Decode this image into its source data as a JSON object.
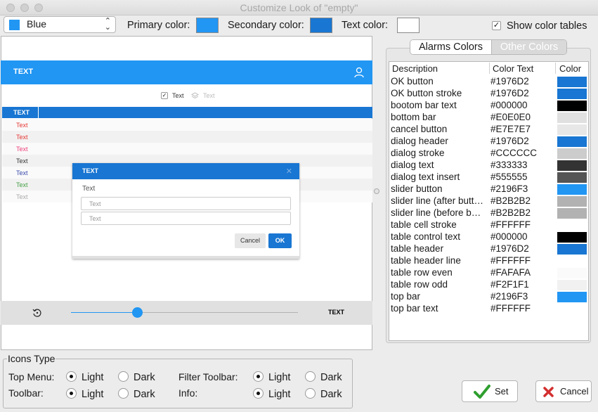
{
  "window": {
    "title": "Customize Look of \"empty\""
  },
  "toolbar": {
    "theme": {
      "selected": "Blue",
      "swatch_color": "#2196F3"
    },
    "primary_label": "Primary color:",
    "primary_color": "#2196F3",
    "secondary_label": "Secondary color:",
    "secondary_color": "#1976D2",
    "text_label": "Text color:",
    "text_color": "#FFFFFF",
    "show_tables_label": "Show color tables",
    "show_tables_checked": true
  },
  "preview": {
    "top_bar_text": "TEXT",
    "filter": {
      "checked_label": "Text",
      "unchecked_label": "Text"
    },
    "table_header": "TEXT",
    "rows": [
      {
        "text": "Text",
        "color": "#E53935"
      },
      {
        "text": "Text",
        "color": "#E53935"
      },
      {
        "text": "Text",
        "color": "#EC407A"
      },
      {
        "text": "Text",
        "color": "#333333"
      },
      {
        "text": "Text",
        "color": "#3949AB"
      },
      {
        "text": "Text",
        "color": "#43A047"
      },
      {
        "text": "Text",
        "color": "#AAAAAA"
      }
    ],
    "dialog": {
      "title": "TEXT",
      "close": "✕",
      "text": "Text",
      "input1_placeholder": "Text",
      "input2_placeholder": "Text",
      "cancel_label": "Cancel",
      "ok_label": "OK"
    },
    "bottom_bar_text": "TEXT",
    "slider_value": 0.29
  },
  "color_tables": {
    "tabs": [
      "Alarms Colors",
      "Other Colors"
    ],
    "active_tab": 0,
    "columns": [
      "Description",
      "Color Text",
      "Color"
    ],
    "rows": [
      {
        "description": "OK button",
        "hex": "#1976D2",
        "swatch": "#1976D2"
      },
      {
        "description": "OK button stroke",
        "hex": "#1976D2",
        "swatch": "#1976D2"
      },
      {
        "description": "bootom bar text",
        "hex": "#000000",
        "swatch": "#000000"
      },
      {
        "description": "bottom bar",
        "hex": "#E0E0E0",
        "swatch": "#E0E0E0"
      },
      {
        "description": "cancel button",
        "hex": "#E7E7E7",
        "swatch": "#E7E7E7"
      },
      {
        "description": "dialog header",
        "hex": "#1976D2",
        "swatch": "#1976D2"
      },
      {
        "description": "dialog stroke",
        "hex": "#CCCCCC",
        "swatch": "#CCCCCC"
      },
      {
        "description": "dialog text",
        "hex": "#333333",
        "swatch": "#333333"
      },
      {
        "description": "dialog text insert",
        "hex": "#555555",
        "swatch": "#555555"
      },
      {
        "description": "slider button",
        "hex": "#2196F3",
        "swatch": "#2196F3"
      },
      {
        "description": "slider line (after butt…",
        "hex": "#B2B2B2",
        "swatch": "#B2B2B2"
      },
      {
        "description": "slider line (before b…",
        "hex": "#B2B2B2",
        "swatch": "#B2B2B2"
      },
      {
        "description": "table cell stroke",
        "hex": "#FFFFFF",
        "swatch": "#FFFFFF"
      },
      {
        "description": "table control text",
        "hex": "#000000",
        "swatch": "#000000"
      },
      {
        "description": "table header",
        "hex": "#1976D2",
        "swatch": "#1976D2"
      },
      {
        "description": "table header line",
        "hex": "#FFFFFF",
        "swatch": "#FFFFFF"
      },
      {
        "description": "table row even",
        "hex": "#FAFAFA",
        "swatch": "#FAFAFA"
      },
      {
        "description": "table row odd",
        "hex": "#F2F1F1",
        "swatch": "#F2F1F1"
      },
      {
        "description": "top bar",
        "hex": "#2196F3",
        "swatch": "#2196F3"
      },
      {
        "description": "top bar text",
        "hex": "#FFFFFF",
        "swatch": "#FFFFFF"
      }
    ]
  },
  "icons_type": {
    "legend": "Icons Type",
    "groups": [
      {
        "label": "Top Menu:",
        "selected": "Light"
      },
      {
        "label": "Toolbar:",
        "selected": "Light"
      },
      {
        "label": "Filter Toolbar:",
        "selected": "Light"
      },
      {
        "label": "Info:",
        "selected": "Light"
      }
    ],
    "light_label": "Light",
    "dark_label": "Dark"
  },
  "actions": {
    "set_label": "Set",
    "cancel_label": "Cancel"
  }
}
